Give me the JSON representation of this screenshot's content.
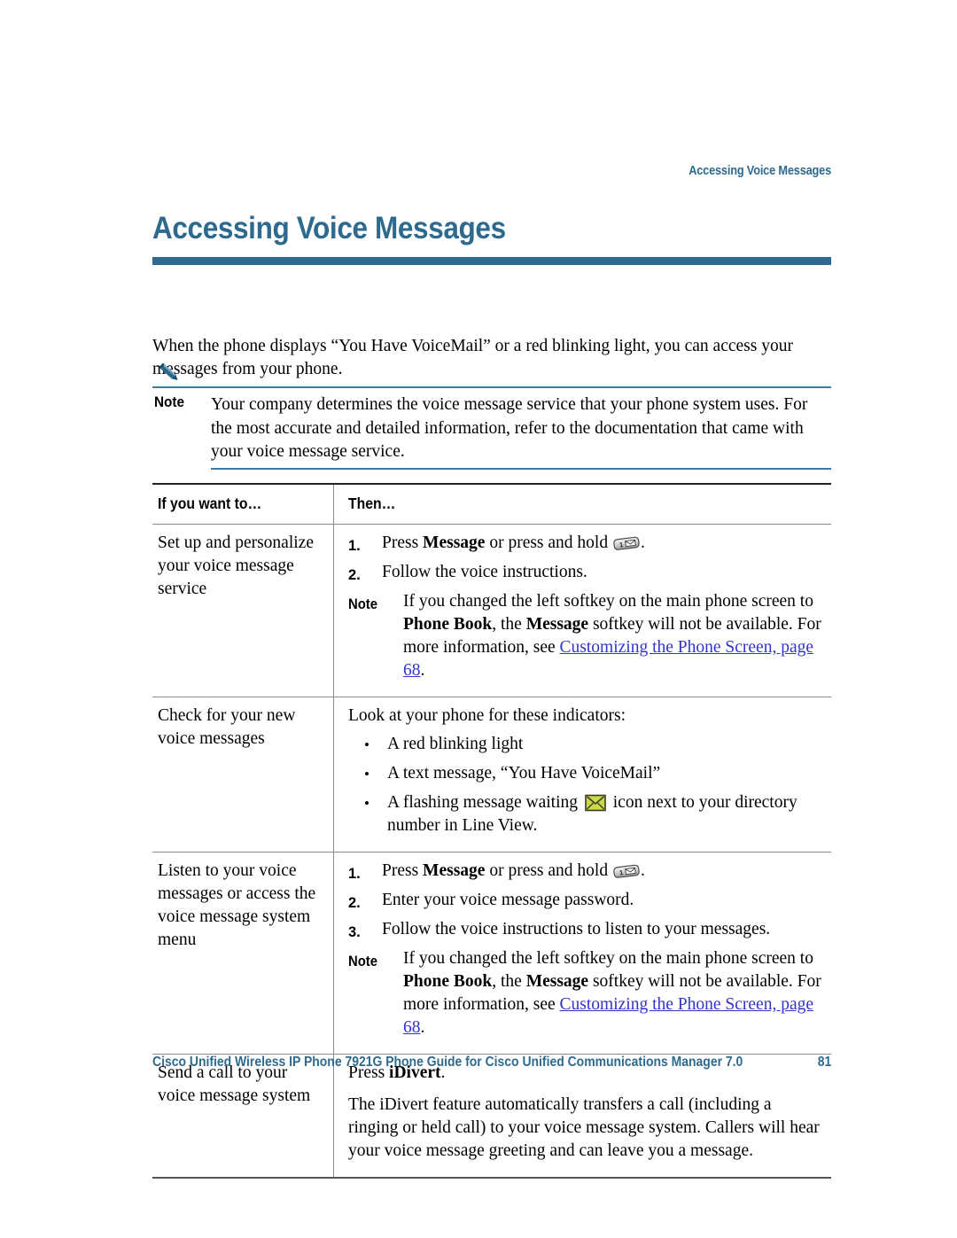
{
  "running_head": "Accessing Voice Messages",
  "chapter_title": "Accessing Voice Messages",
  "intro_paragraph": "When the phone displays “You Have VoiceMail” or a red blinking light, you can access your messages from your phone.",
  "note": {
    "label": "Note",
    "icon": "pencil-icon",
    "body": "Your company determines the voice message service that your phone system uses. For the most accurate and detailed information, refer to the documentation that came with your voice message service."
  },
  "table": {
    "headers": {
      "left": "If you want to…",
      "right": "Then…"
    },
    "rows": [
      {
        "task": "Set up and personalize your voice message service",
        "steps": [
          {
            "num": "1.",
            "pre": "Press ",
            "bold": "Message",
            "post": " or press and hold ",
            "icon": "phone-key-one-voicemail-icon",
            "tail": "."
          },
          {
            "num": "2.",
            "pre": "Follow the voice instructions.",
            "bold": "",
            "post": "",
            "icon": "",
            "tail": ""
          }
        ],
        "note": {
          "label": "Note",
          "seg1": "If you changed the left softkey on the main phone screen to ",
          "bold1": "Phone Book",
          "seg2": ", the ",
          "bold2": "Message",
          "seg3": " softkey will not be available. For more information, see ",
          "xref": "Customizing the Phone Screen, page 68",
          "seg4": "."
        }
      },
      {
        "task": "Check for your new voice messages",
        "lead": "Look at your phone for these indicators:",
        "bullets": [
          {
            "text": "A red blinking light",
            "icon": ""
          },
          {
            "text": "A text message, “You Have VoiceMail”",
            "icon": ""
          },
          {
            "pre": "A flashing message waiting ",
            "icon": "message-waiting-envelope-icon",
            "post": " icon next to your directory number in Line View."
          }
        ]
      },
      {
        "task": "Listen to your voice messages or access the voice message system menu",
        "steps": [
          {
            "num": "1.",
            "pre": "Press ",
            "bold": "Message",
            "post": " or press and hold ",
            "icon": "phone-key-one-voicemail-icon",
            "tail": "."
          },
          {
            "num": "2.",
            "pre": "Enter your voice message password.",
            "bold": "",
            "post": "",
            "icon": "",
            "tail": ""
          },
          {
            "num": "3.",
            "pre": "Follow the voice instructions to listen to your messages.",
            "bold": "",
            "post": "",
            "icon": "",
            "tail": ""
          }
        ],
        "note": {
          "label": "Note",
          "seg1": "If you changed the left softkey on the main phone screen to ",
          "bold1": "Phone Book",
          "seg2": ", the ",
          "bold2": "Message",
          "seg3": " softkey will not be available. For more information, see ",
          "xref": "Customizing the Phone Screen, page 68",
          "seg4": "."
        }
      },
      {
        "task": "Send a call to your voice message system",
        "press_pre": "Press ",
        "press_bold": "iDivert",
        "press_post": ".",
        "body": "The iDivert feature automatically transfers a call (including a ringing or held call) to your voice message system. Callers will hear your voice message greeting and can leave you a message."
      }
    ]
  },
  "footer": {
    "title": "Cisco Unified Wireless IP Phone 7921G Phone Guide for Cisco Unified Communications Manager 7.0",
    "page": "81"
  },
  "colors": {
    "accent_blue": "#2E6A8E",
    "xref_blue": "#3333CC",
    "rule_blue": "#3E7B9E",
    "envelope_fill": "#C9D94A",
    "key_fill": "#C8C8C8"
  }
}
